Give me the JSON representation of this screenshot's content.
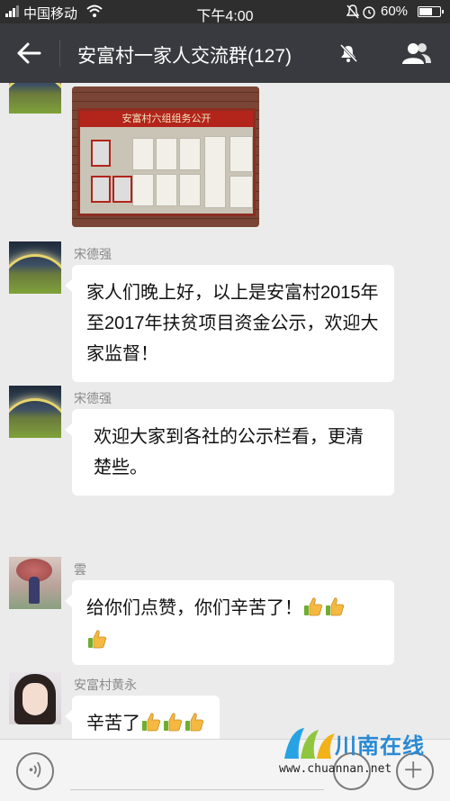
{
  "status_bar": {
    "carrier": "中国移动",
    "time": "下午4:00",
    "battery": "60%",
    "battery_level": 0.6
  },
  "header": {
    "title": "安富村一家人交流群(127)"
  },
  "photo_message": {
    "board_banner": "安富村六组组务公开"
  },
  "messages": [
    {
      "sender": "宋德强",
      "text": "家人们晚上好，以上是安富村2015年至2017年扶贫项目资金公示，欢迎大家监督！"
    },
    {
      "sender": "宋德强",
      "text": "欢迎大家到各社的公示栏看，更清楚些。"
    },
    {
      "sender": "雲",
      "text": "给你们点赞，你们辛苦了！"
    },
    {
      "sender": "安富村黄永",
      "text": "辛苦了"
    }
  ],
  "icons": {
    "emoji": "thumbs-up-emoji"
  },
  "watermark": {
    "name": "川南在线",
    "url": "www.chuannan.net"
  }
}
